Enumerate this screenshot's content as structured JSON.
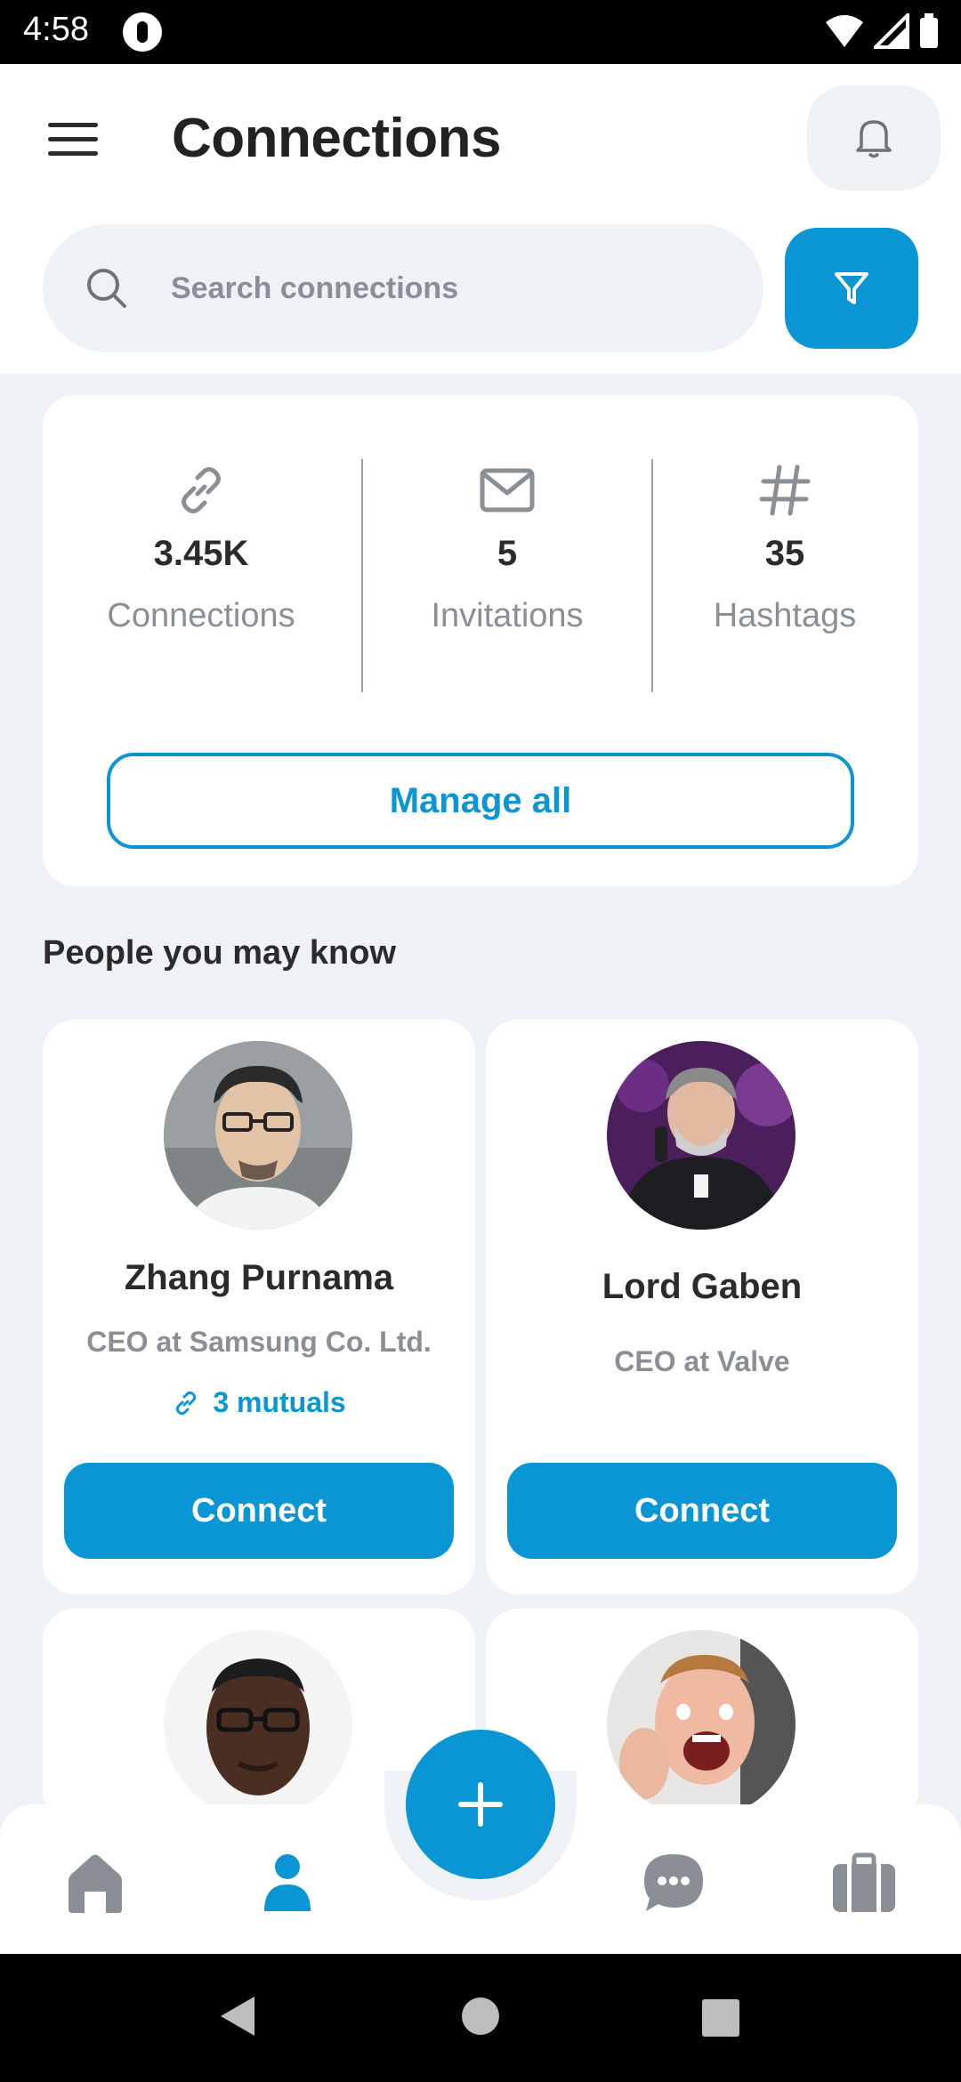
{
  "status_bar": {
    "time": "4:58"
  },
  "header": {
    "title": "Connections",
    "search_placeholder": "Search connections"
  },
  "stats": [
    {
      "icon": "link-icon",
      "value": "3.45K",
      "label": "Connections"
    },
    {
      "icon": "mail-icon",
      "value": "5",
      "label": "Invitations"
    },
    {
      "icon": "hashtag-icon",
      "value": "35",
      "label": "Hashtags"
    }
  ],
  "manage_label": "Manage all",
  "section_title": "People you may know",
  "people": [
    {
      "name": "Zhang Purnama",
      "title": "CEO at Samsung Co. Ltd.",
      "mutuals": "3 mutuals",
      "connect": "Connect"
    },
    {
      "name": "Lord Gaben",
      "title": "CEO at Valve",
      "connect": "Connect"
    }
  ],
  "nav": [
    "home-icon",
    "person-icon",
    "add-icon",
    "chat-icon",
    "briefcase-icon"
  ],
  "colors": {
    "accent": "#0a96d4",
    "background": "#eef1f5",
    "text": "#2b2b2b",
    "muted": "#8a8f96"
  }
}
